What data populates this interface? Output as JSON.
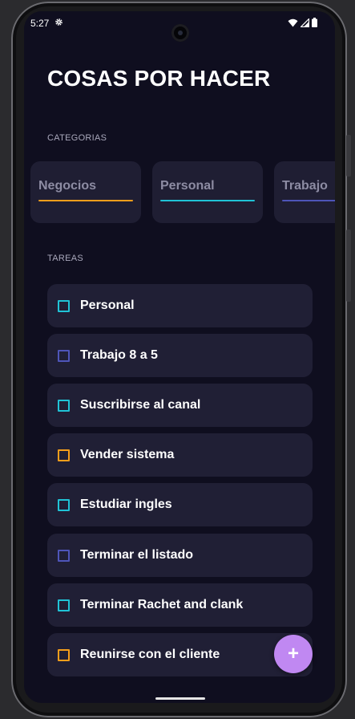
{
  "status_bar": {
    "time": "5:27"
  },
  "header": {
    "title": "COSAS POR HACER"
  },
  "categories_section": {
    "label": "CATEGORIAS",
    "items": [
      {
        "label": "Negocios",
        "color": "#f59e1b"
      },
      {
        "label": "Personal",
        "color": "#20c3d6"
      },
      {
        "label": "Trabajo",
        "color": "#4e55b9"
      }
    ]
  },
  "tasks_section": {
    "label": "TAREAS",
    "items": [
      {
        "label": "Personal",
        "color": "#20c3d6"
      },
      {
        "label": "Trabajo 8 a 5",
        "color": "#4e55b9"
      },
      {
        "label": "Suscribirse al canal",
        "color": "#20c3d6"
      },
      {
        "label": "Vender sistema",
        "color": "#f59e1b"
      },
      {
        "label": "Estudiar ingles",
        "color": "#20c3d6"
      },
      {
        "label": "Terminar el listado",
        "color": "#4e55b9"
      },
      {
        "label": "Terminar Rachet and clank",
        "color": "#20c3d6"
      },
      {
        "label": "Reunirse con el cliente",
        "color": "#f59e1b"
      }
    ]
  },
  "fab": {
    "label": "+",
    "icon": "plus-icon",
    "color": "#c088f2"
  },
  "theme": {
    "background": "#0f0e1f",
    "card": "#201f35"
  }
}
